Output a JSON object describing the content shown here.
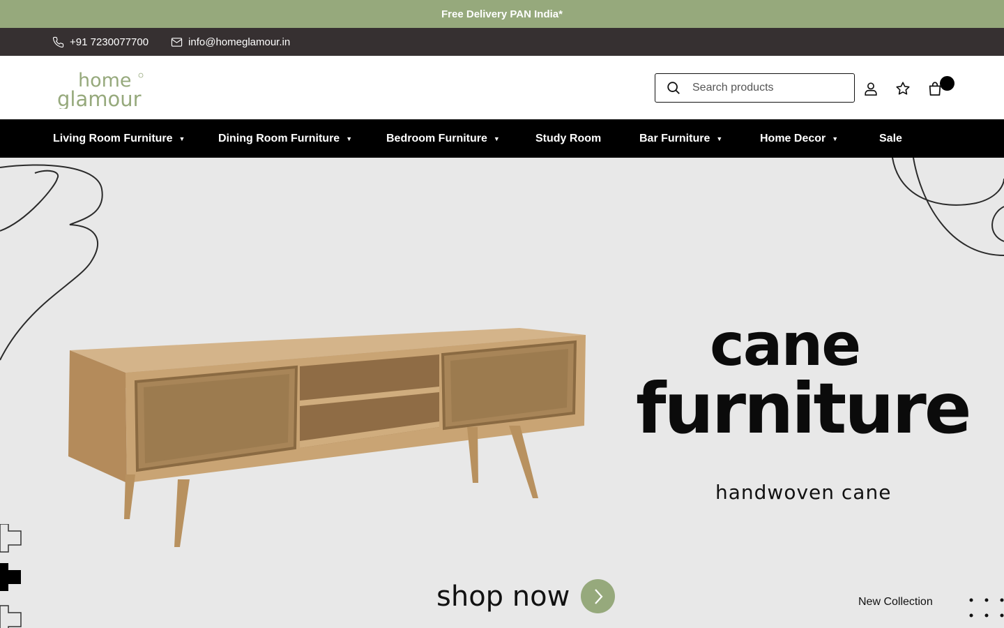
{
  "promo": {
    "text": "Free Delivery PAN India*"
  },
  "contact": {
    "phone": "+91 7230077700",
    "email": "info@homeglamour.in"
  },
  "logo": {
    "line1": "home",
    "line2": "glamour"
  },
  "search": {
    "placeholder": "Search products"
  },
  "cart": {
    "count": ""
  },
  "nav": {
    "items": [
      {
        "label": "Living Room Furniture",
        "dropdown": "⌄"
      },
      {
        "label": "Dining Room Furniture",
        "dropdown": "⌄"
      },
      {
        "label": "Bedroom Furniture",
        "dropdown": "⌄"
      },
      {
        "label": "Study Room"
      },
      {
        "label": "Bar Furniture",
        "dropdown": "⌄"
      },
      {
        "label": "Home Decor",
        "dropdown": "⌄"
      },
      {
        "label": "Sale"
      }
    ]
  },
  "hero": {
    "title_line1": "cane",
    "title_line2": "furniture",
    "subtitle": "handwoven cane",
    "cta": "shop now",
    "tag": "New Collection"
  },
  "colors": {
    "accent_green": "#96a97c",
    "topbar_dark": "#363031",
    "nav_black": "#000000"
  },
  "icons": [
    "phone-icon",
    "mail-icon",
    "search-icon",
    "user-icon",
    "star-icon",
    "bag-icon",
    "chevron-down-icon",
    "arrow-right-icon"
  ]
}
